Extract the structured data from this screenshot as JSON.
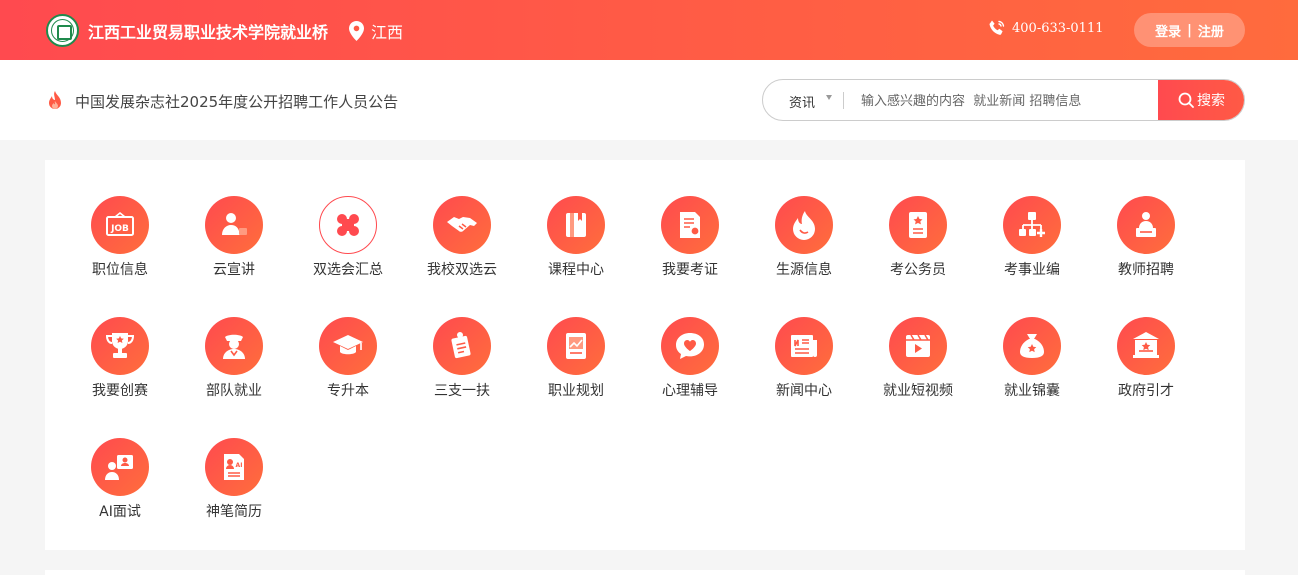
{
  "header": {
    "site_name": "江西工业贸易职业技术学院就业桥",
    "location": "江西",
    "phone": "400-633-0111",
    "login_label": "登录",
    "separator": "|",
    "register_label": "注册"
  },
  "subbar": {
    "announcement": "中国发展杂志社2025年度公开招聘工作人员公告",
    "search_category": "资讯",
    "search_placeholder": "输入感兴趣的内容  就业新闻 招聘信息",
    "search_button": "搜索"
  },
  "colors": {
    "accent": "#ff4a4f",
    "accent_end": "#ff6b3d",
    "logo_green": "#1f8a4c"
  },
  "nav_items": [
    {
      "label": "职位信息",
      "icon": "job-board-icon"
    },
    {
      "label": "云宣讲",
      "icon": "presenter-icon"
    },
    {
      "label": "双选会汇总",
      "icon": "clover-icon"
    },
    {
      "label": "我校双选云",
      "icon": "handshake-icon"
    },
    {
      "label": "课程中心",
      "icon": "book-icon"
    },
    {
      "label": "我要考证",
      "icon": "certificate-icon"
    },
    {
      "label": "生源信息",
      "icon": "flame-icon"
    },
    {
      "label": "考公务员",
      "icon": "civil-exam-icon"
    },
    {
      "label": "考事业编",
      "icon": "org-chart-icon"
    },
    {
      "label": "教师招聘",
      "icon": "teacher-icon"
    },
    {
      "label": "我要创赛",
      "icon": "trophy-icon"
    },
    {
      "label": "部队就业",
      "icon": "soldier-icon"
    },
    {
      "label": "专升本",
      "icon": "graduation-cap-icon"
    },
    {
      "label": "三支一扶",
      "icon": "clipboard-icon"
    },
    {
      "label": "职业规划",
      "icon": "chart-board-icon"
    },
    {
      "label": "心理辅导",
      "icon": "heart-chat-icon"
    },
    {
      "label": "新闻中心",
      "icon": "newspaper-icon"
    },
    {
      "label": "就业短视频",
      "icon": "video-icon"
    },
    {
      "label": "就业锦囊",
      "icon": "money-bag-icon"
    },
    {
      "label": "政府引才",
      "icon": "government-icon"
    },
    {
      "label": "AI面试",
      "icon": "ai-interview-icon"
    },
    {
      "label": "神笔简历",
      "icon": "ai-resume-icon"
    }
  ]
}
